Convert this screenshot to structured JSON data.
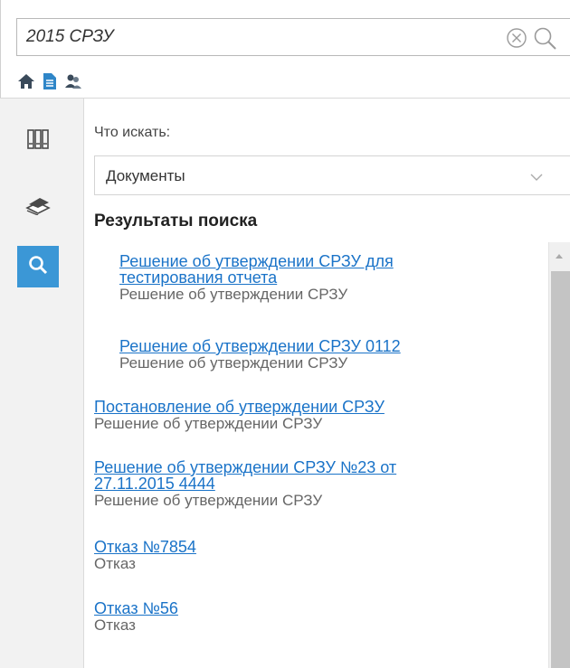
{
  "search": {
    "value": "2015 СРЗУ"
  },
  "toolbar": {
    "icons": [
      "home-icon",
      "document-icon",
      "users-icon"
    ]
  },
  "sidebar": {
    "items": [
      {
        "icon": "catalog-columns-icon",
        "active": false
      },
      {
        "icon": "books-stack-icon",
        "active": false
      },
      {
        "icon": "search-icon",
        "active": true
      }
    ]
  },
  "filter": {
    "label": "Что искать:",
    "selected": "Документы"
  },
  "results": {
    "title": "Результаты поиска",
    "items": [
      {
        "link_line1": "Решение об утверждении СРЗУ для",
        "link_line2": "тестирования отчета",
        "type": "Решение об утверждении СРЗУ"
      },
      {
        "link_line1": "Решение об утверждении СРЗУ 0112",
        "link_line2": "",
        "type": "Решение об утверждении СРЗУ"
      },
      {
        "link_line1": "Постановление об утверждении СРЗУ",
        "link_line2": "",
        "type": "Решение об утверждении СРЗУ"
      },
      {
        "link_line1": "Решение об утверждении СРЗУ №23 от",
        "link_line2": "27.11.2015 4444",
        "type": "Решение об утверждении СРЗУ"
      },
      {
        "link_line1": "Отказ №7854",
        "link_line2": "",
        "type": "Отказ"
      },
      {
        "link_line1": "Отказ №56",
        "link_line2": "",
        "type": "Отказ"
      }
    ]
  },
  "colors": {
    "accent": "#3b97d6",
    "link": "#1a73c8"
  }
}
